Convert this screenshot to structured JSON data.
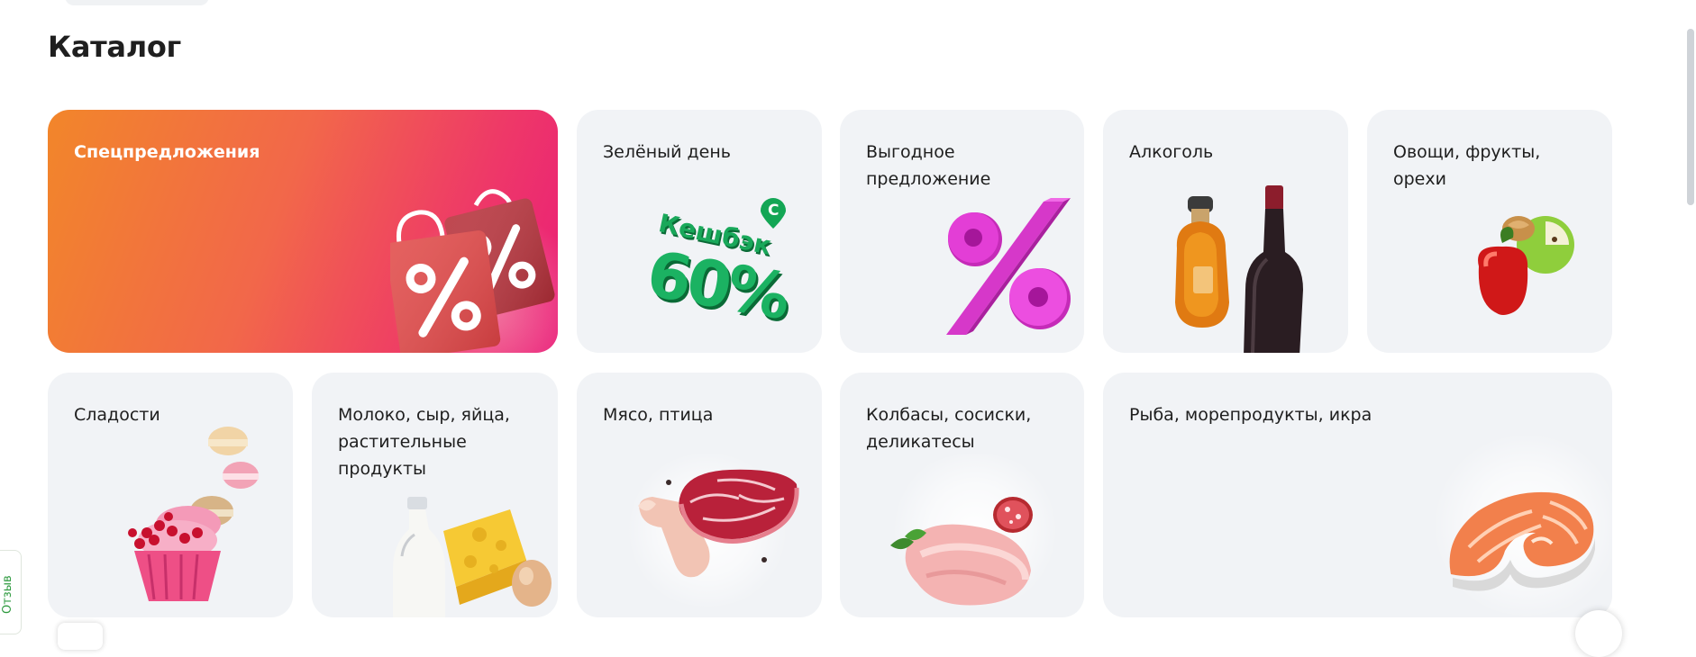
{
  "catalog": {
    "title": "Каталог",
    "categories": [
      {
        "label": "Спецпредложения"
      },
      {
        "label": "Зелёный день"
      },
      {
        "label": "Выгодное предложение"
      },
      {
        "label": "Алкоголь"
      },
      {
        "label": "Овощи, фрукты, орехи"
      },
      {
        "label": "Сладости"
      },
      {
        "label": "Молоко, сыр, яйца, растительные продукты"
      },
      {
        "label": "Мясо, птица"
      },
      {
        "label": "Колбасы, сосиски, деликатесы"
      },
      {
        "label": "Рыба, морепродукты, икра"
      }
    ]
  },
  "badges": {
    "cashback_word": "Кешбэк",
    "cashback_value": "60%",
    "cashback_symbol": "С"
  },
  "icons": [
    "shopping-bags-percent-icon",
    "cashback-60-icon",
    "percent-icon",
    "bottles-icon",
    "pepper-apple-walnut-icon",
    "cupcake-macarons-icon",
    "milk-cheese-egg-icon",
    "meat-steak-icon",
    "ham-salami-icon",
    "salmon-steak-icon"
  ],
  "colors": {
    "promo_gradient_start": "#f2862a",
    "promo_gradient_end": "#ea1e78",
    "card_background": "#f1f3f6",
    "cashback_green": "#1aa85b",
    "percent_magenta": "#e23ed4",
    "feedback_green": "#2e9a3f"
  },
  "feedback": {
    "label": "Отзыв"
  }
}
